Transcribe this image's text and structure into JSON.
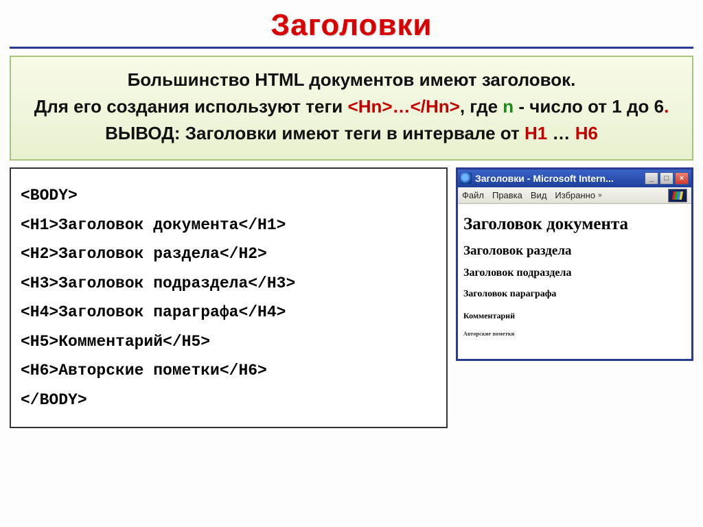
{
  "title": "Заголовки",
  "info": {
    "line1": "Большинство HTML документов имеют заголовок.",
    "line2_pre": "Для его создания используют теги ",
    "tag_open": "<Hn>",
    "dots": "…",
    "tag_close": "</Hn>",
    "line2_post": ", где ",
    "n": "n",
    "line2_tail": " - число от 1 до 6",
    "dot": ".",
    "line3_pre": "ВЫВОД: Заголовки имеют теги в интервале от ",
    "h1": "H1",
    "ell": " … ",
    "h6": "H6"
  },
  "code": {
    "body_open": "<BODY>",
    "l1": "<H1>Заголовок документа</H1>",
    "l2": "<H2>Заголовок раздела</H2>",
    "l3": "<H3>Заголовок подраздела</H3>",
    "l4": "<H4>Заголовок параграфа</H4>",
    "l5": "<H5>Комментарий</H5>",
    "l6": "<H6>Авторские пометки</H6>",
    "body_close": "</BODY>"
  },
  "ie": {
    "title": "Заголовки - Microsoft Intern...",
    "menu": {
      "file": "Файл",
      "edit": "Правка",
      "view": "Вид",
      "fav": "Избранно"
    },
    "h1": "Заголовок документа",
    "h2": "Заголовок раздела",
    "h3": "Заголовок подраздела",
    "h4": "Заголовок параграфа",
    "h5": "Комментарий",
    "h6": "Авторские пометки",
    "min": "_",
    "max": "□",
    "close": "×",
    "chev": "»"
  }
}
